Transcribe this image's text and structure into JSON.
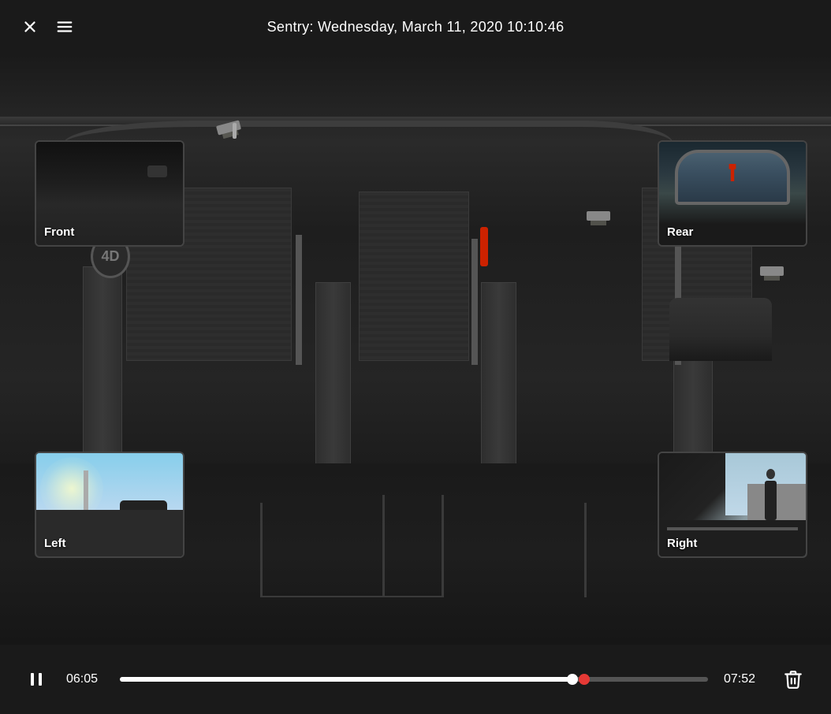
{
  "header": {
    "title": "Sentry: Wednesday, March 11, 2020 10:10:46",
    "close_label": "Close",
    "menu_label": "Menu"
  },
  "cameras": {
    "front": {
      "label": "Front"
    },
    "rear": {
      "label": "Rear"
    },
    "left": {
      "label": "Left"
    },
    "right": {
      "label": "Right"
    }
  },
  "controls": {
    "current_time": "06:05",
    "total_time": "07:52",
    "progress_percent": 77,
    "pause_label": "Pause",
    "delete_label": "Delete"
  },
  "parking_sign": "4D"
}
